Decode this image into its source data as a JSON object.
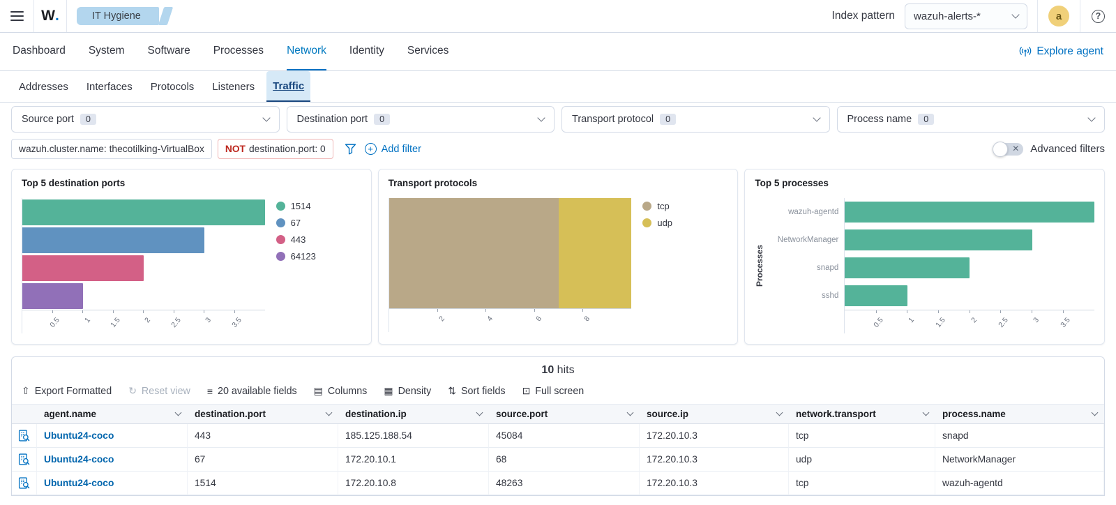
{
  "header": {
    "logo": "W.",
    "app_tab": "IT Hygiene",
    "index_pattern_label": "Index pattern",
    "index_pattern_value": "wazuh-alerts-*",
    "avatar": "a",
    "help": "?"
  },
  "main_tabs": {
    "items": [
      "Dashboard",
      "System",
      "Software",
      "Processes",
      "Network",
      "Identity",
      "Services"
    ],
    "active": "Network",
    "explore_agent": "Explore agent"
  },
  "sub_tabs": {
    "items": [
      "Addresses",
      "Interfaces",
      "Protocols",
      "Listeners",
      "Traffic"
    ],
    "active": "Traffic"
  },
  "filters": {
    "dropdowns": [
      {
        "label": "Source port",
        "count": "0"
      },
      {
        "label": "Destination port",
        "count": "0"
      },
      {
        "label": "Transport protocol",
        "count": "0"
      },
      {
        "label": "Process name",
        "count": "0"
      }
    ],
    "pills": [
      {
        "negated": false,
        "text": "wazuh.cluster.name: thecotilking-VirtualBox"
      },
      {
        "negated": true,
        "prefix": "NOT",
        "text": "destination.port: 0"
      }
    ],
    "add_filter": "Add filter",
    "advanced_filters": "Advanced filters"
  },
  "chart_data": [
    {
      "type": "bar",
      "orientation": "horizontal",
      "title": "Top 5 destination ports",
      "categories": [
        "1514",
        "67",
        "443",
        "64123"
      ],
      "values": [
        4,
        3,
        2,
        1
      ],
      "bar_colors": [
        "#54b399",
        "#6092c0",
        "#d36086",
        "#9170b8"
      ],
      "xticks": [
        "0.5",
        "1",
        "1.5",
        "2",
        "2.5",
        "3",
        "3.5"
      ],
      "xlim": [
        0,
        4
      ],
      "legend": [
        "1514",
        "67",
        "443",
        "64123"
      ],
      "legend_position": "right",
      "show_category_labels": false
    },
    {
      "type": "bar_stacked",
      "orientation": "horizontal",
      "title": "Transport protocols",
      "series": [
        {
          "name": "tcp",
          "value": 7,
          "color": "#b9a888"
        },
        {
          "name": "udp",
          "value": 3,
          "color": "#d6bf57"
        }
      ],
      "xticks": [
        "2",
        "4",
        "6",
        "8"
      ],
      "xlim": [
        0,
        10
      ],
      "legend": [
        "tcp",
        "udp"
      ],
      "legend_position": "right"
    },
    {
      "type": "bar",
      "orientation": "horizontal",
      "title": "Top 5 processes",
      "categories": [
        "wazuh-agentd",
        "NetworkManager",
        "snapd",
        "sshd"
      ],
      "values": [
        4,
        3,
        2,
        1
      ],
      "bar_colors": [
        "#54b399",
        "#54b399",
        "#54b399",
        "#54b399"
      ],
      "xticks": [
        "0.5",
        "1",
        "1.5",
        "2",
        "2.5",
        "3",
        "3.5"
      ],
      "xlim": [
        0,
        4
      ],
      "ylabel": "Processes",
      "show_category_labels": true
    }
  ],
  "results": {
    "hits_count": "10",
    "hits_label": "hits",
    "toolbar": [
      {
        "label": "Export Formatted",
        "icon": "export-icon",
        "glyph": "⇧",
        "disabled": false
      },
      {
        "label": "Reset view",
        "icon": "reset-icon",
        "glyph": "↻",
        "disabled": true
      },
      {
        "label": "20 available fields",
        "icon": "fields-icon",
        "glyph": "≡",
        "disabled": false
      },
      {
        "label": "Columns",
        "icon": "columns-icon",
        "glyph": "▤",
        "disabled": false
      },
      {
        "label": "Density",
        "icon": "density-icon",
        "glyph": "▦",
        "disabled": false
      },
      {
        "label": "Sort fields",
        "icon": "sort-icon",
        "glyph": "⇅",
        "disabled": false
      },
      {
        "label": "Full screen",
        "icon": "fullscreen-icon",
        "glyph": "⊡",
        "disabled": false
      }
    ],
    "table": {
      "columns": [
        "agent.name",
        "destination.port",
        "destination.ip",
        "source.port",
        "source.ip",
        "network.transport",
        "process.name"
      ],
      "rows": [
        [
          "Ubuntu24-coco",
          "443",
          "185.125.188.54",
          "45084",
          "172.20.10.3",
          "tcp",
          "snapd"
        ],
        [
          "Ubuntu24-coco",
          "67",
          "172.20.10.1",
          "68",
          "172.20.10.3",
          "udp",
          "NetworkManager"
        ],
        [
          "Ubuntu24-coco",
          "1514",
          "172.20.10.8",
          "48263",
          "172.20.10.3",
          "tcp",
          "wazuh-agentd"
        ]
      ]
    }
  },
  "colors": {
    "accent_blue": "#0071c2",
    "link_blue": "#0065ad",
    "danger_red": "#bd271e",
    "active_subtab_bg": "#d6e9f7",
    "app_tab_blue": "#b3d6ee",
    "avatar_yellow": "#f0d079"
  }
}
